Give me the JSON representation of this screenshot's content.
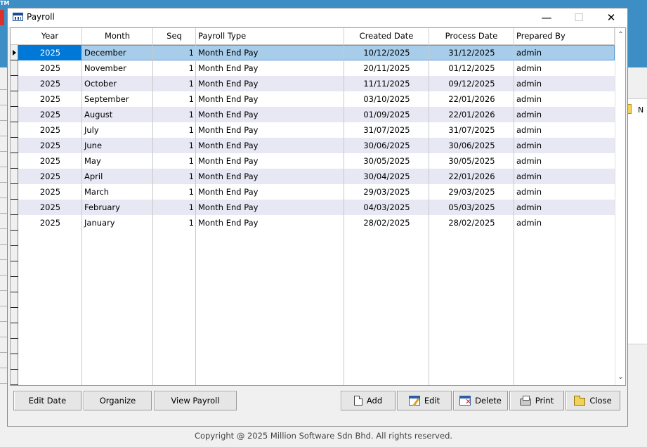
{
  "window": {
    "title": "Payroll"
  },
  "background": {
    "tm": "TM",
    "right_text": "N"
  },
  "grid": {
    "columns": [
      "Year",
      "Month",
      "Seq",
      "Payroll Type",
      "Created Date",
      "Process Date",
      "Prepared By"
    ],
    "rows": [
      [
        "2025",
        "December",
        "1",
        "Month End Pay",
        "10/12/2025",
        "31/12/2025",
        "admin"
      ],
      [
        "2025",
        "November",
        "1",
        "Month End Pay",
        "20/11/2025",
        "01/12/2025",
        "admin"
      ],
      [
        "2025",
        "October",
        "1",
        "Month End Pay",
        "11/11/2025",
        "09/12/2025",
        "admin"
      ],
      [
        "2025",
        "September",
        "1",
        "Month End Pay",
        "03/10/2025",
        "22/01/2026",
        "admin"
      ],
      [
        "2025",
        "August",
        "1",
        "Month End Pay",
        "01/09/2025",
        "22/01/2026",
        "admin"
      ],
      [
        "2025",
        "July",
        "1",
        "Month End Pay",
        "31/07/2025",
        "31/07/2025",
        "admin"
      ],
      [
        "2025",
        "June",
        "1",
        "Month End Pay",
        "30/06/2025",
        "30/06/2025",
        "admin"
      ],
      [
        "2025",
        "May",
        "1",
        "Month End Pay",
        "30/05/2025",
        "30/05/2025",
        "admin"
      ],
      [
        "2025",
        "April",
        "1",
        "Month End Pay",
        "30/04/2025",
        "22/01/2026",
        "admin"
      ],
      [
        "2025",
        "March",
        "1",
        "Month End Pay",
        "29/03/2025",
        "29/03/2025",
        "admin"
      ],
      [
        "2025",
        "February",
        "1",
        "Month End Pay",
        "04/03/2025",
        "05/03/2025",
        "admin"
      ],
      [
        "2025",
        "January",
        "1",
        "Month End Pay",
        "28/02/2025",
        "28/02/2025",
        "admin"
      ]
    ],
    "selected_row": 0,
    "empty_indicator_rows": 10
  },
  "buttons": {
    "edit_date": "Edit Date",
    "organize": "Organize",
    "view_payroll": "View Payroll",
    "add": "Add",
    "edit": "Edit",
    "delete": "Delete",
    "print": "Print",
    "close": "Close"
  },
  "footer": {
    "copyright": "Copyright @ 2025 Million Software Sdn Bhd. All rights reserved."
  },
  "colors": {
    "selection_row": "#a8cdeb",
    "focus_cell": "#0078d7",
    "alt_row": "#e8e8f4",
    "title_bar": "#3d8ec5"
  }
}
